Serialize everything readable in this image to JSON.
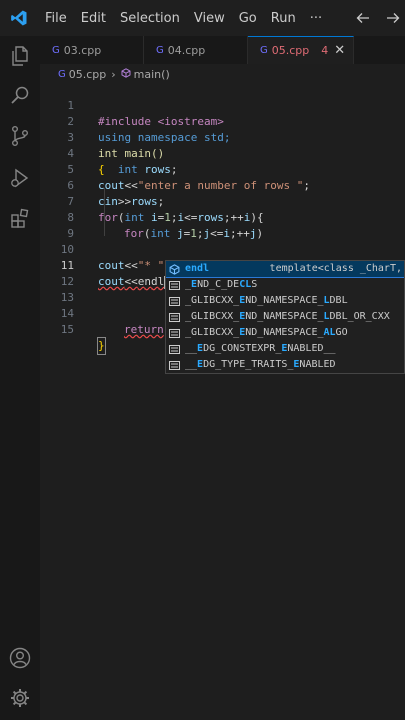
{
  "menu": [
    "File",
    "Edit",
    "Selection",
    "View",
    "Go",
    "Run"
  ],
  "menu_more": "···",
  "tabs": [
    {
      "label": "03.cpp",
      "active": false
    },
    {
      "label": "04.cpp",
      "active": false
    },
    {
      "label": "05.cpp",
      "active": true,
      "problems": "4"
    }
  ],
  "breadcrumb": {
    "file": "05.cpp",
    "symbol": "main()"
  },
  "file_icon_glyph": "G",
  "editor": {
    "current_line": 11,
    "lines": [
      {
        "n": "1"
      },
      {
        "n": "2"
      },
      {
        "n": "3"
      },
      {
        "n": "4"
      },
      {
        "n": "5"
      },
      {
        "n": "6"
      },
      {
        "n": "7"
      },
      {
        "n": "8"
      },
      {
        "n": "9"
      },
      {
        "n": "10"
      },
      {
        "n": "11"
      },
      {
        "n": "12"
      },
      {
        "n": "13"
      },
      {
        "n": "14"
      },
      {
        "n": "15"
      }
    ],
    "code": {
      "l1": "#include <iostream>",
      "l2": "using namespace std;",
      "l3": "int main()",
      "l4a": "{",
      "l4b": "  int ",
      "l4c": "rows",
      "l4d": ";",
      "l5a": "cout",
      "l5b": "<<",
      "l5c": "\"enter a number of rows \"",
      "l5d": ";",
      "l6a": "cin",
      "l6b": ">>",
      "l6c": "rows",
      "l6d": ";",
      "l7a": "for",
      "l7b": "(",
      "l7c": "int",
      "l7d": " i",
      "l7e": "=",
      "l7f": "1",
      "l7g": ";",
      "l7h": "i",
      "l7i": "<=",
      "l7j": "rows",
      "l7k": ";++",
      "l7l": "i",
      "l7m": "){",
      "l8a": "for",
      "l8b": "(",
      "l8c": "int",
      "l8d": " j",
      "l8e": "=",
      "l8f": "1",
      "l8g": ";",
      "l8h": "j",
      "l8i": "<=",
      "l8j": "i",
      "l8k": ";++",
      "l8l": "j",
      "l8m": ")",
      "l10a": "cout",
      "l10b": "<<",
      "l10c": "\"* \"",
      "l10d": ";",
      "l10e": ")",
      "l11a": "cout",
      "l11b": "<<",
      "l11c": "endl",
      "l14": "return",
      "l15": "}"
    }
  },
  "suggestions": [
    {
      "pre": "",
      "hl": "endl",
      "post": "",
      "detail": "template<class _CharT,",
      "kind": "symbol",
      "selected": true
    },
    {
      "pre": "_",
      "hl": "E",
      "mid": "ND_C_DE",
      "hl2": "CL",
      "post": "S",
      "kind": "keyword"
    },
    {
      "pre": "_GLIBCXX_",
      "hl": "E",
      "mid": "ND_NAMESPACE_",
      "hl2": "L",
      "post": "DBL",
      "kind": "keyword"
    },
    {
      "pre": "_GLIBCXX_",
      "hl": "E",
      "mid": "ND_NAMESPACE_",
      "hl2": "L",
      "post": "DBL_OR_CXX",
      "kind": "keyword"
    },
    {
      "pre": "_GLIBCXX_",
      "hl": "E",
      "mid": "ND_NAMESPACE_",
      "hl2": "AL",
      "post": "GO",
      "kind": "keyword"
    },
    {
      "pre": "__",
      "hl": "E",
      "mid": "DG_CONSTEXPR_",
      "hl2": "E",
      "post": "NABLED__",
      "kind": "keyword"
    },
    {
      "pre": "__",
      "hl": "E",
      "mid": "DG_TYPE_TRAITS_",
      "hl2": "E",
      "post": "NABLED",
      "kind": "keyword"
    }
  ],
  "colors": {
    "accent": "#0078d4",
    "modified": "#e06c75",
    "match": "#2aaaff"
  }
}
